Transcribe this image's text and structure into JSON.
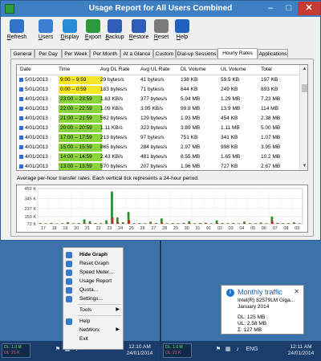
{
  "window": {
    "title": "Usage Report for All Users Combined",
    "min": "–",
    "max": "□",
    "close": "✕"
  },
  "toolbar": [
    {
      "key": "R",
      "rest": "efresh",
      "icon": "refresh-icon",
      "color": "#2f74c9"
    },
    {
      "key": "U",
      "rest": "sers",
      "icon": "users-icon",
      "color": "#3b7fd1"
    },
    {
      "key": "D",
      "rest": "isplay",
      "icon": "display-icon",
      "color": "#2a8bd6"
    },
    {
      "key": "E",
      "rest": "xport",
      "icon": "export-icon",
      "color": "#2a9a3a"
    },
    {
      "key": "B",
      "rest": "ackup",
      "icon": "backup-icon",
      "color": "#2f5db8"
    },
    {
      "key": "R",
      "rest": "estore",
      "icon": "restore-icon",
      "color": "#2f5db8"
    },
    {
      "key": "R",
      "rest": "eset",
      "icon": "reset-icon",
      "color": "#7a7a7a"
    },
    {
      "key": "H",
      "rest": "elp",
      "icon": "help-icon",
      "color": "#2060c0"
    }
  ],
  "tabs": [
    "General",
    "Per Day",
    "Per Week",
    "Per Month",
    "At a Glance",
    "Custom",
    "Dial-up Sessions",
    "Hourly Rates",
    "Applications"
  ],
  "active_tab": "Hourly Rates",
  "table": {
    "columns": [
      "Date",
      "Time",
      "Avg DL Rate",
      "Avg UL Rate",
      "DL Volume",
      "UL Volume",
      "Total"
    ],
    "rows": [
      {
        "date": "5/01/2013",
        "time": "9:00 – 9:59",
        "dl_rate": "29 bytes/s",
        "ul_rate": "41 bytes/s",
        "dl_vol": "138 KB",
        "ul_vol": "59.5 KB",
        "total": "197 KB",
        "tc": "#f5e628"
      },
      {
        "date": "5/01/2013",
        "time": "0:00 – 0:59",
        "dl_rate": "183 bytes/s",
        "ul_rate": "71 bytes/s",
        "dl_vol": "644 KB",
        "ul_vol": "249 KB",
        "total": "893 KB",
        "tc": "#f5e628"
      },
      {
        "date": "4/01/2013",
        "time": "23:00 – 23:59",
        "dl_rate": "1.63 KB/s",
        "ul_rate": "377 bytes/s",
        "dl_vol": "5.94 MB",
        "ul_vol": "1.29 MB",
        "total": "7.23 MB",
        "tc": "#8ad33a"
      },
      {
        "date": "4/01/2013",
        "time": "22:00 – 22:59",
        "dl_rate": "1.09 KB/s",
        "ul_rate": "3.95 KB/s",
        "dl_vol": "99.8 MB",
        "ul_vol": "13.9 MB",
        "total": "114 MB",
        "tc": "#8ad33a"
      },
      {
        "date": "4/01/2013",
        "time": "21:00 – 21:59",
        "dl_rate": "562 bytes/s",
        "ul_rate": "129 bytes/s",
        "dl_vol": "1.93 MB",
        "ul_vol": "454 KB",
        "total": "2.38 MB",
        "tc": "#8ad33a"
      },
      {
        "date": "4/01/2013",
        "time": "20:00 – 20:59",
        "dl_rate": "1.11 KB/s",
        "ul_rate": "323 bytes/s",
        "dl_vol": "3.89 MB",
        "ul_vol": "1.11 MB",
        "total": "5.00 MB",
        "tc": "#8ad33a"
      },
      {
        "date": "4/01/2013",
        "time": "17:00 – 17:59",
        "dl_rate": "213 bytes/s",
        "ul_rate": "97 bytes/s",
        "dl_vol": "751 KB",
        "ul_vol": "341 KB",
        "total": "1.07 MB",
        "tc": "#8ad33a"
      },
      {
        "date": "4/01/2013",
        "time": "15:00 – 15:59",
        "dl_rate": "865 bytes/s",
        "ul_rate": "284 bytes/s",
        "dl_vol": "2.97 MB",
        "ul_vol": "998 KB",
        "total": "3.95 MB",
        "tc": "#8ad33a"
      },
      {
        "date": "4/01/2013",
        "time": "14:00 – 14:59",
        "dl_rate": "2.43 KB/s",
        "ul_rate": "481 bytes/s",
        "dl_vol": "8.55 MB",
        "ul_vol": "1.65 MB",
        "total": "10.2 MB",
        "tc": "#8ad33a"
      },
      {
        "date": "4/01/2013",
        "time": "13:00 – 13:59",
        "dl_rate": "570 bytes/s",
        "ul_rate": "207 bytes/s",
        "dl_vol": "1.96 MB",
        "ul_vol": "727 KB",
        "total": "2.67 MB",
        "tc": "#8ad33a"
      }
    ]
  },
  "caption": "Average per-hour transfer rates. Each vertical tick represents a 24-hour period.",
  "chart_data": {
    "type": "bar",
    "y_ticks": [
      "452 K",
      "345 K",
      "237 K",
      "150 K",
      "72 K"
    ],
    "y_tick_values": [
      452,
      345,
      237,
      150,
      72
    ],
    "ylim": [
      72,
      452
    ],
    "x_ticks": [
      "17",
      "18",
      "19",
      "20",
      "21",
      "22",
      "23",
      "24",
      "25",
      "26",
      "27",
      "28",
      "29",
      "30",
      "31",
      "01",
      "02",
      "03",
      "04",
      "05",
      "06",
      "07",
      "08",
      "09"
    ],
    "series": [
      {
        "values": [
          80,
          78,
          82,
          76,
          79,
          90,
          78,
          80,
          120,
          100,
          80,
          79,
          110,
          420,
          140,
          90,
          200,
          80,
          79,
          78,
          95,
          80,
          130,
          78,
          80,
          79,
          82,
          100,
          79,
          80,
          85,
          78,
          110,
          80,
          79,
          81,
          78,
          96,
          80,
          79,
          85,
          78,
          150,
          82,
          79,
          80,
          88,
          78
        ],
        "color": "#2e8b2e"
      },
      {
        "values": [
          74,
          73,
          75,
          73,
          74,
          76,
          73,
          74,
          80,
          77,
          74,
          73,
          78,
          140,
          90,
          76,
          110,
          73,
          74,
          73,
          77,
          74,
          85,
          73,
          74,
          73,
          75,
          78,
          73,
          74,
          76,
          73,
          80,
          74,
          73,
          75,
          73,
          77,
          74,
          73,
          76,
          73,
          95,
          75,
          73,
          74,
          77,
          73
        ],
        "color": "#cc2a1a"
      }
    ],
    "colors": {
      "download": "#2e8b2e",
      "upload": "#cc2a1a",
      "highlight": "#e8c21a"
    }
  },
  "taskbar_left": {
    "dl": "DL: 1.0 M",
    "ul": "UL: 21 K",
    "time": "12:10 AM",
    "date": "24/01/2014"
  },
  "taskbar_right": {
    "dl": "DL: 1.0 M",
    "ul": "UL: 21 K",
    "time": "12:11 AM",
    "date": "24/01/2014",
    "lang": "ENG"
  },
  "context_menu": [
    {
      "label": "Hide Graph",
      "bold": true,
      "icon": "graph-icon",
      "sep_after": false
    },
    {
      "label": "Reset Graph",
      "icon": "reset-graph-icon",
      "sep_after": false
    },
    {
      "label": "Speed Meter...",
      "icon": "speed-meter-icon",
      "sep_after": false
    },
    {
      "label": "Usage Report",
      "icon": "usage-report-icon",
      "sep_after": false
    },
    {
      "label": "Quota...",
      "icon": "quota-icon",
      "sep_after": false
    },
    {
      "label": "Settings...",
      "icon": "settings-icon",
      "sep_after": true
    },
    {
      "label": "Tools",
      "icon": "",
      "arrow": true,
      "sep_after": true
    },
    {
      "label": "Help",
      "icon": "help-icon",
      "sep_after": false
    },
    {
      "label": "NetWorx",
      "icon": "",
      "arrow": true,
      "sep_after": false
    },
    {
      "label": "Exit",
      "icon": "",
      "sep_after": false
    }
  ],
  "popup": {
    "title": "Monthly traffic",
    "adapter": "Intel(R) 82579LM Giga...",
    "period": "January 2014",
    "dl": "DL: 125 MB",
    "ul": "UL: 2.58 MB",
    "sum": "Σ: 127 MB",
    "close": "✕"
  }
}
